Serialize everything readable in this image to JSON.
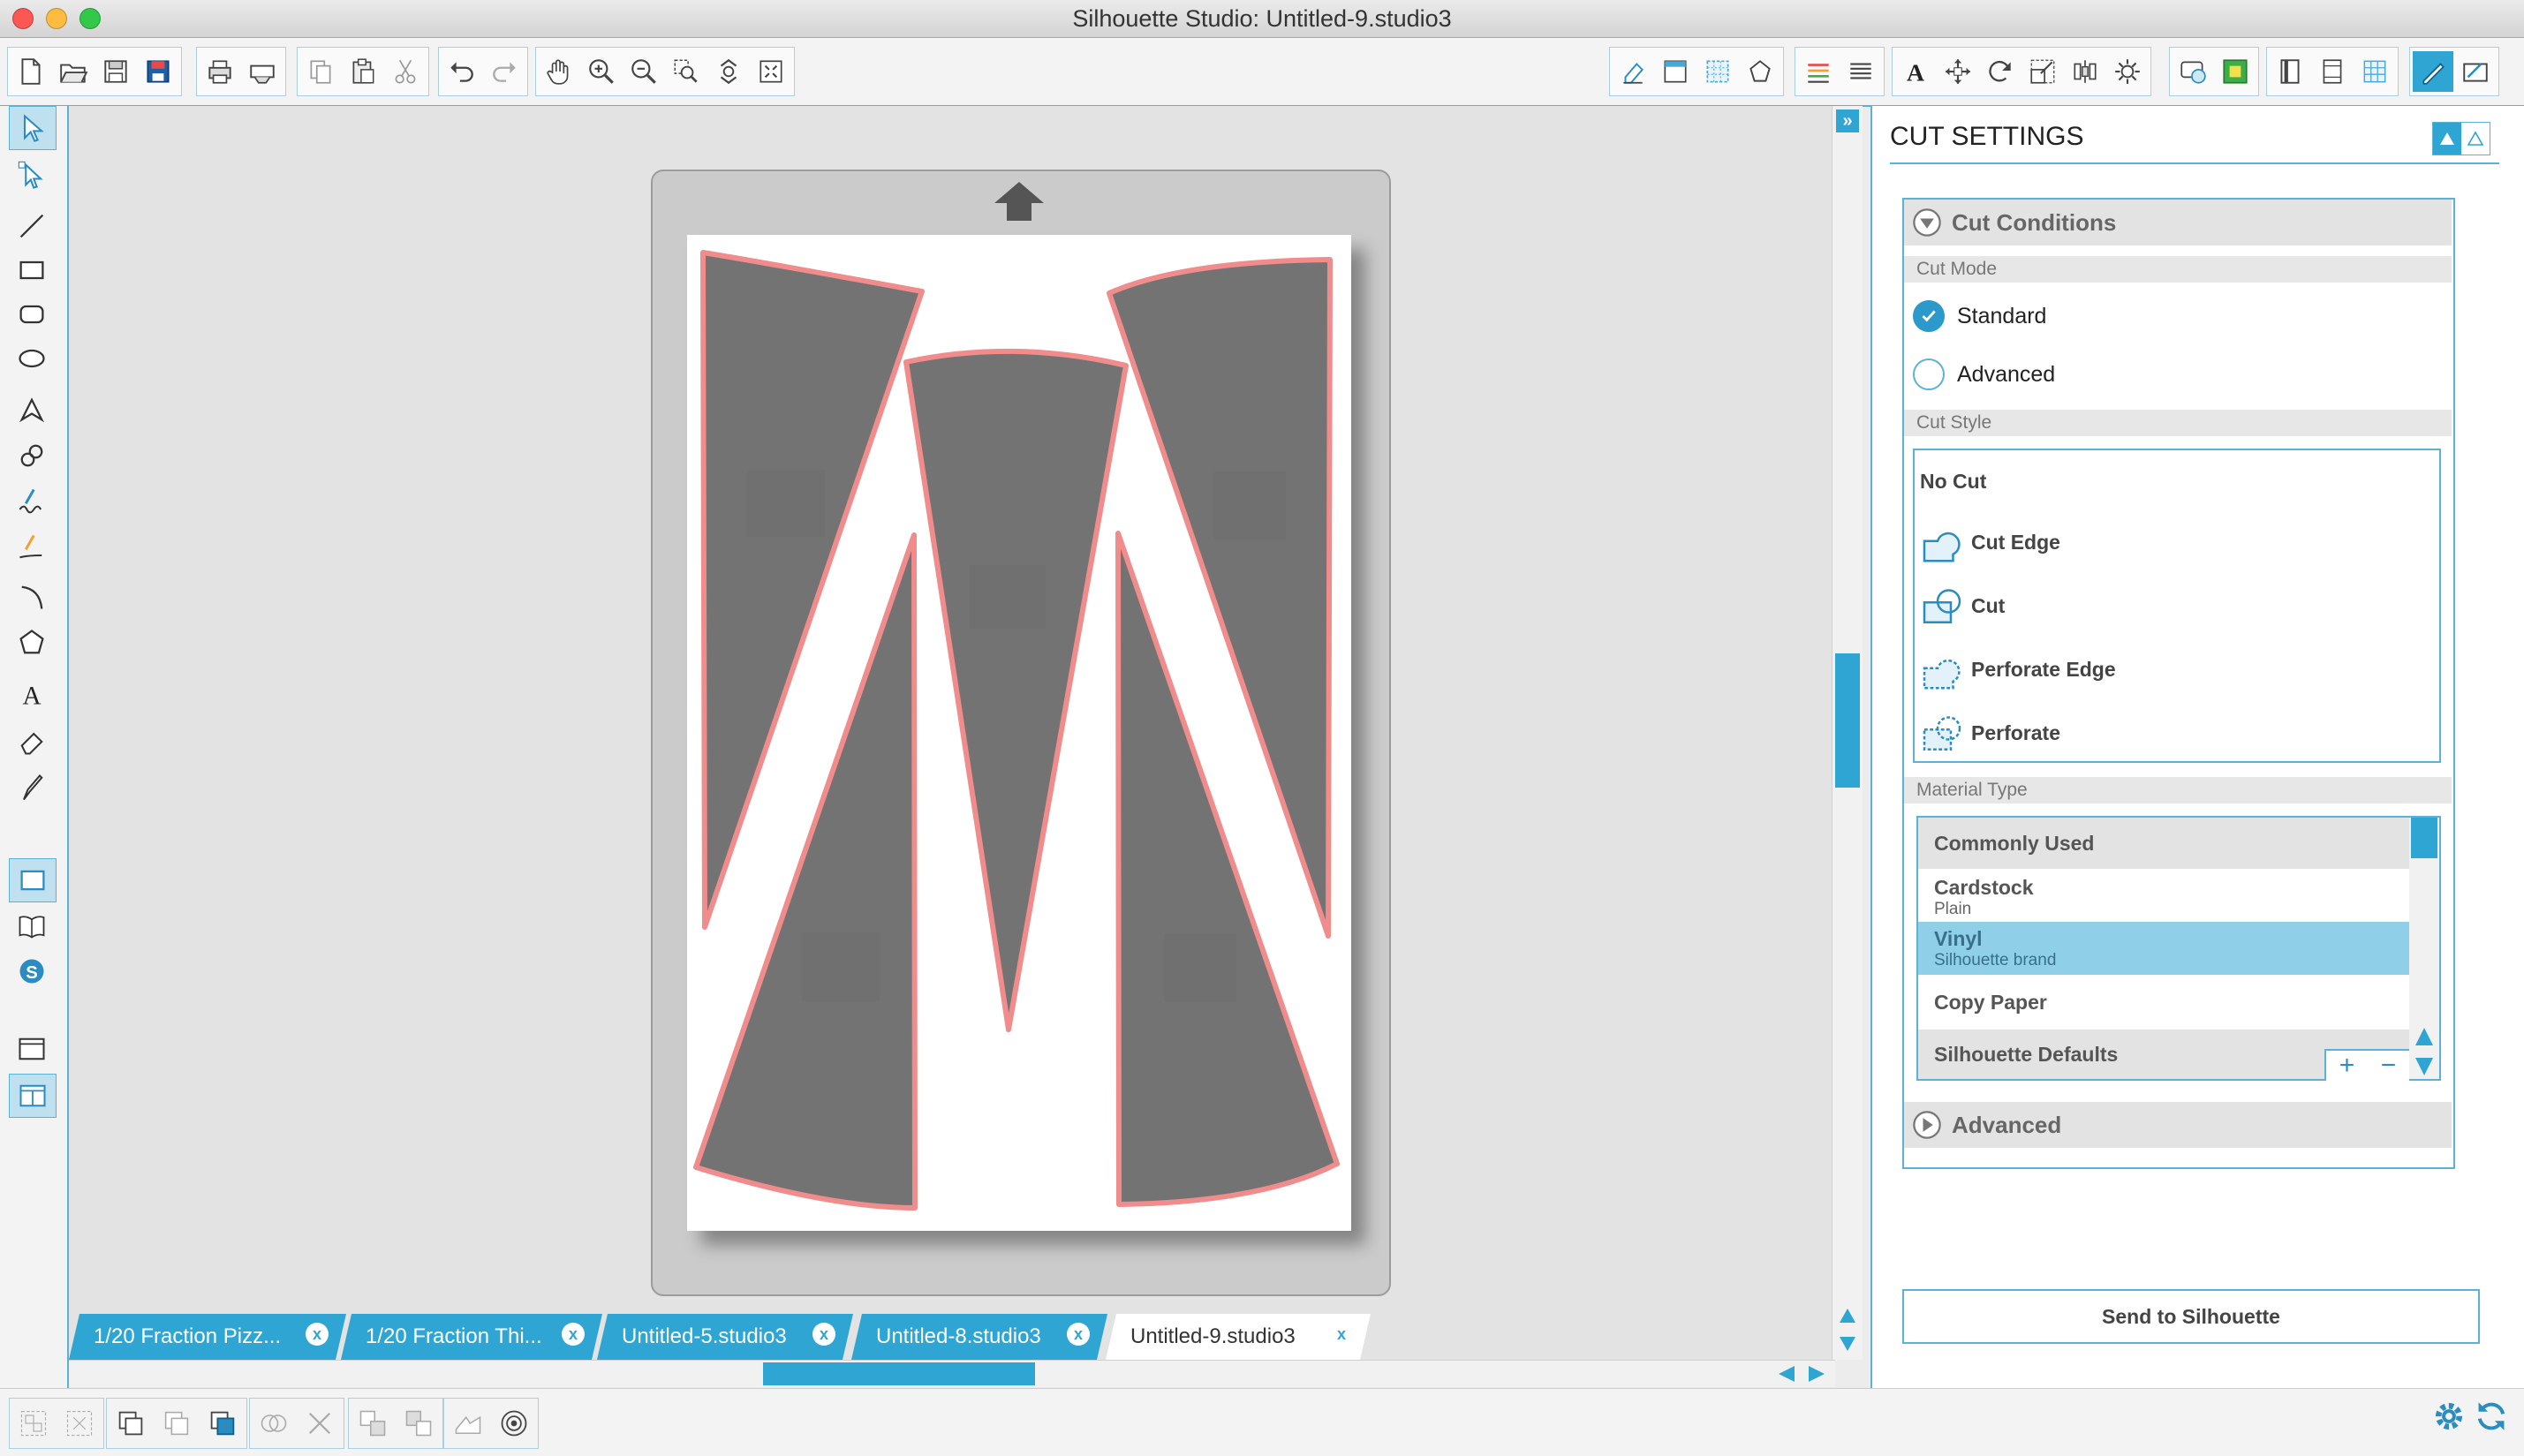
{
  "window": {
    "title": "Silhouette Studio: Untitled-9.studio3"
  },
  "tabs": [
    {
      "label": "1/20 Fraction Pizz...",
      "close": "x"
    },
    {
      "label": "1/20 Fraction Thi...",
      "close": "x"
    },
    {
      "label": "Untitled-5.studio3",
      "close": "x"
    },
    {
      "label": "Untitled-8.studio3",
      "close": "x"
    },
    {
      "label": "Untitled-9.studio3",
      "close": "x"
    }
  ],
  "panel": {
    "title": "CUT SETTINGS",
    "cut_conditions": {
      "header": "Cut Conditions",
      "cut_mode_label": "Cut Mode",
      "modes": [
        {
          "label": "Standard",
          "checked": true
        },
        {
          "label": "Advanced",
          "checked": false
        }
      ],
      "cut_style_label": "Cut Style",
      "styles": [
        "No Cut",
        "Cut Edge",
        "Cut",
        "Perforate Edge",
        "Perforate"
      ],
      "material_type_label": "Material Type",
      "materials": [
        {
          "name": "Commonly Used",
          "sub": ""
        },
        {
          "name": "Cardstock",
          "sub": "Plain"
        },
        {
          "name": "Vinyl",
          "sub": "Silhouette brand",
          "selected": true
        },
        {
          "name": "Copy Paper",
          "sub": ""
        },
        {
          "name": "Silhouette Defaults",
          "sub": ""
        }
      ],
      "add_symbol": "+",
      "remove_symbol": "−"
    },
    "advanced": {
      "header": "Advanced"
    },
    "send_button": "Send to Silhouette"
  },
  "icons": {
    "toolbar": [
      "new-icon",
      "open-icon",
      "save-icon",
      "save-to-library-icon",
      "print-icon",
      "print-to-cutter-icon",
      "copy-icon",
      "paste-icon",
      "cut-icon",
      "undo-icon",
      "redo-icon",
      "pan-icon",
      "zoom-in-icon",
      "zoom-out-icon",
      "zoom-select-icon",
      "drag-zoom-icon",
      "fit-to-page-icon",
      "eraser-tool-icon",
      "page-settings-icon",
      "grid-settings-icon",
      "registration-icon",
      "line-style-icon",
      "fill-icon",
      "text-style-icon",
      "transform-icon",
      "rotate-icon",
      "scale-icon",
      "align-icon",
      "replicate-icon",
      "offset-icon",
      "trace-icon",
      "send-to-icon",
      "library-icon",
      "cut-settings-icon"
    ],
    "bottom": [
      "group-icon",
      "ungroup-icon",
      "make-compound-icon",
      "release-compound-icon",
      "fill-shape-icon",
      "weld-icon",
      "delete-icon",
      "bring-forward-icon",
      "send-backward-icon",
      "settings-gear-icon",
      "sync-icon"
    ]
  },
  "colors": {
    "accent": "#2ea5d3",
    "shape_fill": "#737373",
    "shape_stroke": "#f08c8c",
    "selected_row": "#8fcfe8"
  }
}
